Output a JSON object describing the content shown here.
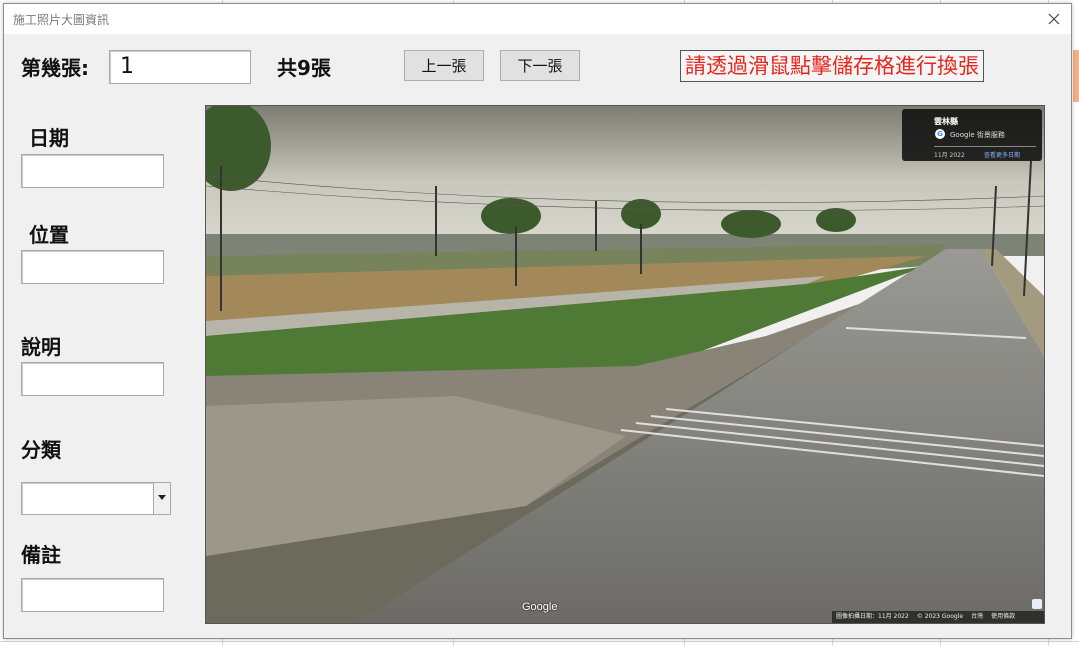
{
  "window": {
    "title": "施工照片大圖資訊"
  },
  "nav": {
    "page_label": "第幾張:",
    "page_value": "1",
    "total_label": "共9張",
    "prev_button": "上一張",
    "next_button": "下一張",
    "hint": "請透過滑鼠點擊儲存格進行換張"
  },
  "fields": {
    "date_label": "日期",
    "date_value": "",
    "location_label": "位置",
    "location_value": "",
    "description_label": "說明",
    "description_value": "",
    "category_label": "分類",
    "category_value": "",
    "remarks_label": "備註",
    "remarks_value": ""
  },
  "photo": {
    "panel_title": "雲林縣",
    "panel_subtitle": "Google 街景服務",
    "panel_date": "11月 2022",
    "panel_link": "查看更多日期",
    "logo": "Google",
    "footer_date": "圖像拍攝日期：11月 2022",
    "footer_copyright": "© 2023 Google",
    "footer_region": "台灣",
    "footer_terms": "使用條款"
  },
  "colors": {
    "hint_text": "#e8261b",
    "window_bg": "#f0f0f0"
  }
}
